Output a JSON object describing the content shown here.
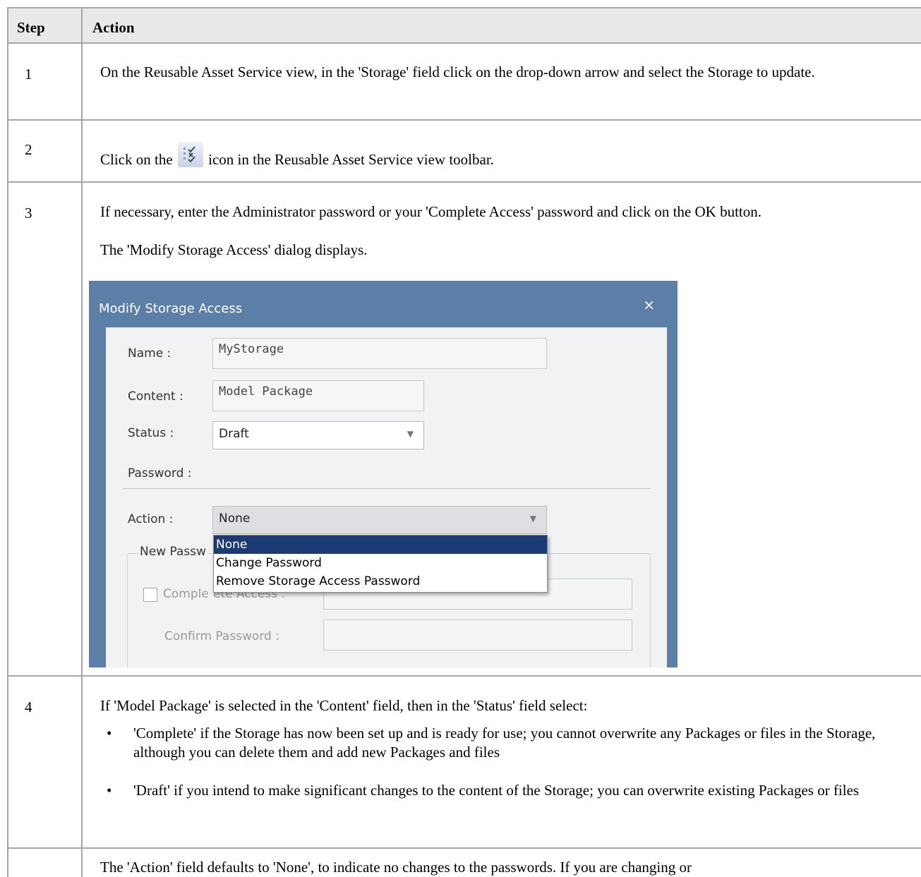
{
  "table": {
    "headers": {
      "step": "Step",
      "action": "Action"
    },
    "rows": {
      "r1": {
        "step": "1",
        "text": "On the Reusable Asset Service view, in the 'Storage' field click on the drop-down arrow and select the Storage to update."
      },
      "r2": {
        "step": "2",
        "before": "Click on the",
        "after": "icon in the Reusable Asset Service view toolbar.",
        "icon": "check-list-icon"
      },
      "r3": {
        "step": "3",
        "text1": "If necessary, enter the Administrator password or your 'Complete Access' password and click on the OK button.",
        "text2": "The 'Modify Storage Access' dialog displays."
      },
      "r4": {
        "step": "4",
        "intro": "If 'Model Package' is selected in the 'Content' field, then in the 'Status' field select:",
        "bullets": [
          "'Complete' if the Storage has now been set up and is ready for use; you cannot overwrite any Packages or files in the Storage, although you can delete them and add new Packages and files",
          "'Draft' if you intend to make significant changes to the content of the Storage; you can overwrite existing Packages or files"
        ]
      },
      "r5": {
        "text": "The 'Action' field defaults to 'None', to indicate no changes to the passwords. If you are changing or"
      }
    }
  },
  "dialog": {
    "title": "Modify Storage Access",
    "close_glyph": "×",
    "name_label": "Name :",
    "name_value": "MyStorage",
    "content_label": "Content :",
    "content_value": "Model Package",
    "status_label": "Status :",
    "status_value": "Draft",
    "password_label": "Password :",
    "action_label": "Action :",
    "action_value": "None",
    "action_options": [
      "None",
      "Change Password",
      "Remove Storage Access Password"
    ],
    "group_label": "New Passw",
    "complete_access_label": "Comple",
    "complete_access_label_overlap": "ete Access :",
    "confirm_password_label": "Confirm Password :"
  },
  "colors": {
    "dialog_frame": "#5b7fa6",
    "selected_item": "#1c3a73",
    "header_bg": "#e9e9e9",
    "border": "#a6a6a6"
  }
}
